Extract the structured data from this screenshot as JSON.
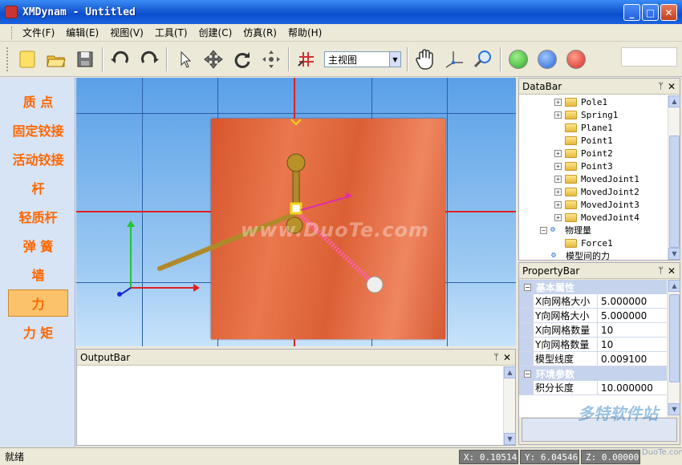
{
  "window": {
    "title": "XMDynam - Untitled",
    "minimize": "_",
    "maximize": "□",
    "close": "✕"
  },
  "menu": [
    {
      "label": "文件(F)"
    },
    {
      "label": "编辑(E)"
    },
    {
      "label": "视图(V)"
    },
    {
      "label": "工具(T)"
    },
    {
      "label": "创建(C)"
    },
    {
      "label": "仿真(R)"
    },
    {
      "label": "帮助(H)"
    }
  ],
  "toolbar": {
    "view_select": "主视图",
    "icons": [
      "new-icon",
      "open-icon",
      "save-icon",
      "undo-icon",
      "redo-icon",
      "select-arrow-icon",
      "move-icon",
      "rotate-icon",
      "pan-icon",
      "grid-icon",
      "hand-icon",
      "axis-icon",
      "zoom-icon",
      "play-icon",
      "pause-icon",
      "stop-icon"
    ]
  },
  "left_panel": {
    "items": [
      {
        "label": "质 点"
      },
      {
        "label": "固定铰接"
      },
      {
        "label": "活动铰接"
      },
      {
        "label": "杆"
      },
      {
        "label": "轻质杆"
      },
      {
        "label": "弹 簧"
      },
      {
        "label": "墙"
      },
      {
        "label": "力",
        "selected": true
      },
      {
        "label": "力 矩"
      }
    ]
  },
  "viewport": {
    "watermark": "www.DuoTe.com"
  },
  "output_bar": {
    "title": "OutputBar",
    "pin": "ᛘ",
    "close": "✕"
  },
  "data_bar": {
    "title": "DataBar",
    "pin": "ᛘ",
    "close": "✕",
    "items": [
      {
        "label": "Pole1",
        "expander": "+"
      },
      {
        "label": "Spring1",
        "expander": "+"
      },
      {
        "label": "Plane1",
        "expander": ""
      },
      {
        "label": "Point1",
        "expander": ""
      },
      {
        "label": "Point2",
        "expander": "+"
      },
      {
        "label": "Point3",
        "expander": "+"
      },
      {
        "label": "MovedJoint1",
        "expander": "+"
      },
      {
        "label": "MovedJoint2",
        "expander": "+"
      },
      {
        "label": "MovedJoint3",
        "expander": "+"
      },
      {
        "label": "MovedJoint4",
        "expander": "+"
      },
      {
        "label": "物理量",
        "expander": "−",
        "root": true
      },
      {
        "label": "Force1",
        "expander": ""
      },
      {
        "label": "模型间的力",
        "expander": "",
        "root": true
      }
    ]
  },
  "property_bar": {
    "title": "PropertyBar",
    "pin": "ᛘ",
    "close": "✕",
    "categories": [
      {
        "label": "基本属性",
        "rows": [
          {
            "name": "X向网格大小",
            "value": "5.000000"
          },
          {
            "name": "Y向网格大小",
            "value": "5.000000"
          },
          {
            "name": "X向网格数量",
            "value": "10"
          },
          {
            "name": "Y向网格数量",
            "value": "10"
          },
          {
            "name": "模型线度",
            "value": "0.009100"
          }
        ]
      },
      {
        "label": "环境参数",
        "rows": [
          {
            "name": "积分长度",
            "value": "10.000000"
          }
        ]
      }
    ]
  },
  "status": {
    "text": "就绪",
    "x": "X: 0.10514",
    "y": "Y: 6.04546",
    "z": "Z: 0.00000"
  },
  "brand_watermark": {
    "text": "多特软件站",
    "sub": "DuoTe.com"
  }
}
